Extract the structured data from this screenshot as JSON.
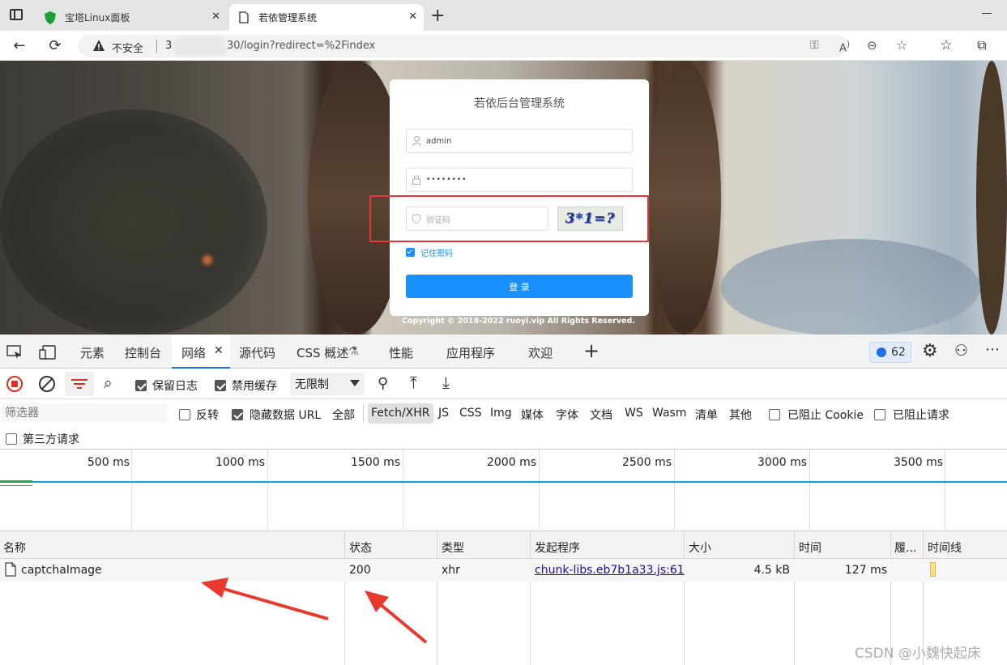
{
  "browser": {
    "tabs": [
      {
        "title": "宝塔Linux面板"
      },
      {
        "title": "若依管理系统"
      }
    ],
    "address": {
      "security_label": "不安全",
      "url_prefix": "3",
      "url_suffix": "30/login?redirect=%2Findex"
    }
  },
  "login": {
    "title": "若依后台管理系统",
    "username_value": "admin",
    "password_value": "••••••••",
    "captcha_placeholder": "验证码",
    "captcha_image_text": "3*1=?",
    "remember_label": "记住密码",
    "submit_label": "登 录",
    "copyright": "Copyright © 2018-2022 ruoyi.vip All Rights Reserved."
  },
  "devtools": {
    "tabs": [
      "元素",
      "控制台",
      "网络",
      "源代码",
      "CSS 概述",
      "性能",
      "应用程序",
      "欢迎"
    ],
    "active_tab": "网络",
    "issues_count": "62",
    "toolbar": {
      "preserve_log": "保留日志",
      "disable_cache": "禁用缓存",
      "throttle": "无限制"
    },
    "filter": {
      "placeholder": "筛选器",
      "invert": "反转",
      "hide_data_urls": "隐藏数据 URL",
      "all": "全部",
      "types": [
        "Fetch/XHR",
        "JS",
        "CSS",
        "Img",
        "媒体",
        "字体",
        "文档",
        "WS",
        "Wasm",
        "清单",
        "其他"
      ],
      "blocked_cookies": "已阻止 Cookie",
      "blocked_requests": "已阻止请求",
      "third_party": "第三方请求"
    },
    "timeline_ticks": [
      "500 ms",
      "1000 ms",
      "1500 ms",
      "2000 ms",
      "2500 ms",
      "3000 ms",
      "3500 ms"
    ],
    "columns": [
      "名称",
      "状态",
      "类型",
      "发起程序",
      "大小",
      "时间",
      "履...",
      "时间线"
    ],
    "rows": [
      {
        "name": "captchaImage",
        "status": "200",
        "type": "xhr",
        "initiator": "chunk-libs.eb7b1a33.js:61",
        "size": "4.5 kB",
        "time": "127 ms"
      }
    ]
  },
  "watermark": "CSDN @小魏快起床",
  "colors": {
    "accent": "#1890ff",
    "highlight": "#e53935",
    "annotation_arrow": "#e8392f"
  }
}
